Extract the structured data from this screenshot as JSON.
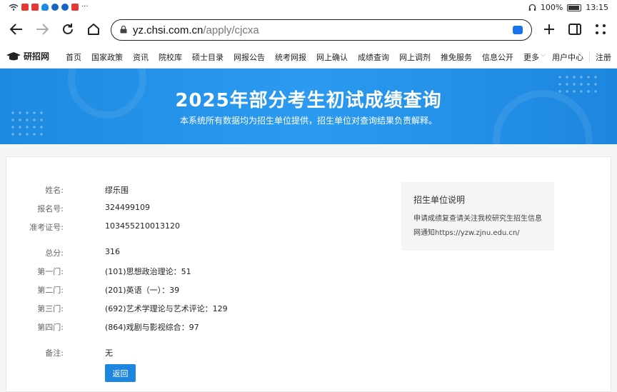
{
  "status_bar": {
    "battery": "100%",
    "time": "13:15"
  },
  "browser": {
    "url_host": "yz.chsi.com.cn",
    "url_path": "/apply/cjcxa"
  },
  "site_nav": {
    "logo": "研招网",
    "items": [
      "首页",
      "国家政策",
      "资讯",
      "院校库",
      "硕士目录",
      "网报公告",
      "统考网报",
      "网上确认",
      "成绩查询",
      "网上调剂",
      "推免服务",
      "信息公开",
      "更多"
    ],
    "user_center": "用户中心",
    "register": "注册"
  },
  "banner": {
    "title": "2025年部分考生初试成绩查询",
    "subtitle": "本系统所有数据均为招生单位提供，招生单位对查询结果负责解释。"
  },
  "result": {
    "name_label": "姓名:",
    "name": "缪乐围",
    "reg_label": "报名号:",
    "reg_no": "324499109",
    "ticket_label": "准考证号:",
    "ticket_no": "103455210013120",
    "total_label": "总分:",
    "total": "316",
    "s1_label": "第一门:",
    "s1": "(101)思想政治理论：51",
    "s2_label": "第二门:",
    "s2": "(201)英语（一）：39",
    "s3_label": "第三门:",
    "s3": "(692)艺术学理论与艺术评论：129",
    "s4_label": "第四门:",
    "s4": "(864)戏剧与影视综合：97",
    "remark_label": "备注:",
    "remark": "无",
    "back_button": "返回"
  },
  "notice": {
    "title": "招生单位说明",
    "body": "申请成绩复查请关注我校研究生招生信息网通知https://yzw.zjnu.edu.cn/"
  }
}
